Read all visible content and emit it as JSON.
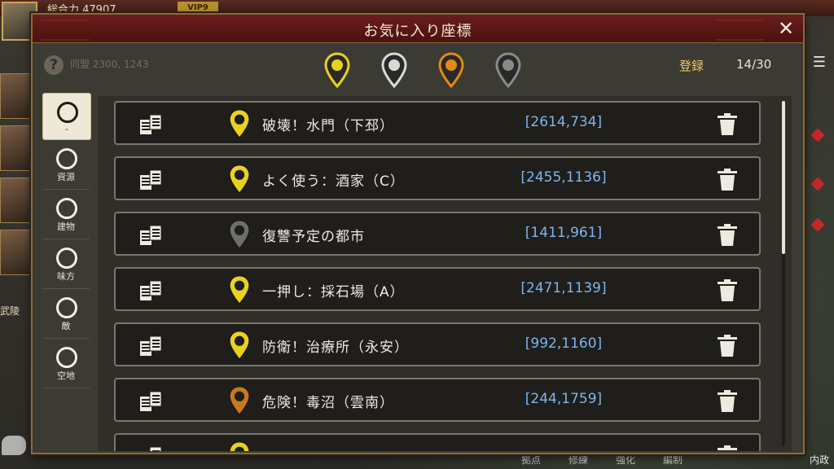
{
  "background": {
    "power_text": "総合力 47907",
    "vip_text": "VIP9",
    "bg_coord": "同盟 2300, 1243",
    "left_label": "武陵",
    "right_label": "内政",
    "bottom_labels": [
      "拠点",
      "修練",
      "強化",
      "編制"
    ]
  },
  "dialog": {
    "title": "お気に入り座標",
    "close_symbol": "✕",
    "help_symbol": "?",
    "register_label": "登録",
    "register_count": "14/30",
    "pin_filters": [
      {
        "name": "yellow",
        "color": "#e8d21e",
        "selected": true
      },
      {
        "name": "gray",
        "color": "#d9d9d9",
        "selected": false
      },
      {
        "name": "orange",
        "color": "#e08a18",
        "selected": false
      },
      {
        "name": "dark",
        "color": "#8a8a8a",
        "selected": false
      }
    ]
  },
  "categories": [
    {
      "label": "-",
      "active": true
    },
    {
      "label": "資源",
      "active": false
    },
    {
      "label": "建物",
      "active": false
    },
    {
      "label": "味方",
      "active": false
    },
    {
      "label": "敵",
      "active": false
    },
    {
      "label": "空地",
      "active": false
    }
  ],
  "bookmarks": [
    {
      "name": "破壊！水門（下邳）",
      "coord": "[2614,734]",
      "pin_color": "#e8d21e"
    },
    {
      "name": "よく使う：酒家（C）",
      "coord": "[2455,1136]",
      "pin_color": "#e8d21e"
    },
    {
      "name": "復讐予定の都市",
      "coord": "[1411,961]",
      "pin_color": "#6e6e6e"
    },
    {
      "name": "一押し：採石場（A）",
      "coord": "[2471,1139]",
      "pin_color": "#e8d21e"
    },
    {
      "name": "防衛！治療所（永安）",
      "coord": "[992,1160]",
      "pin_color": "#e8d21e"
    },
    {
      "name": "危険！毒沼（雲南）",
      "coord": "[244,1759]",
      "pin_color": "#c87a18"
    },
    {
      "name": "",
      "coord": "",
      "pin_color": "#e8d21e"
    }
  ],
  "scroll": {
    "position": 0,
    "visible_fraction": 0.45
  }
}
